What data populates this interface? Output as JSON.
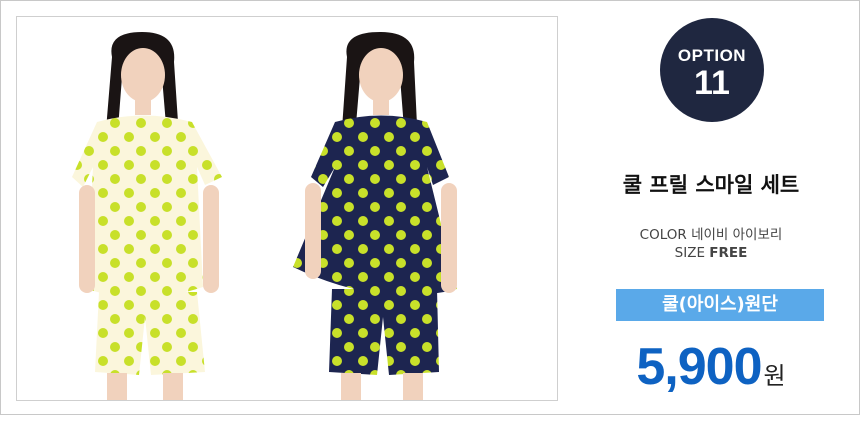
{
  "product": {
    "option_word": "OPTION",
    "option_number": "11",
    "name": "쿨 프릴 스마일 세트",
    "color_label": "COLOR",
    "colors": "네이비 아이보리",
    "size_label": "SIZE",
    "size_value": "FREE",
    "fabric": "쿨(아이스)원단",
    "price": "5,900",
    "price_unit": "원"
  },
  "theme": {
    "badge_bg": "#1f2740",
    "fabric_bg": "#5aa9e9",
    "price_color": "#0e62c2",
    "ivory": "#fbf6dc",
    "navy": "#1d2550",
    "smiley": "#c8e02a"
  }
}
